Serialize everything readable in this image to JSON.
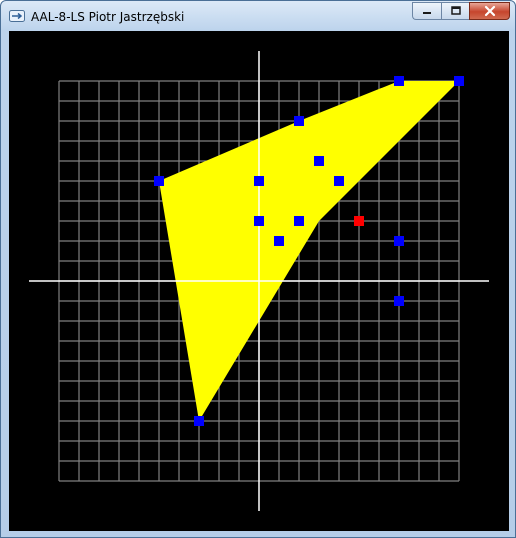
{
  "window": {
    "title": "AAL-8-LS Piotr Jastrzębski",
    "icon": "app-window-icon",
    "buttons": [
      "minimize-icon",
      "maximize-icon",
      "close-icon"
    ]
  },
  "plot": {
    "grid": {
      "range": [
        -10,
        10
      ],
      "step": 1
    },
    "colors": {
      "background": "#000000",
      "grid": "#808080",
      "axes": "#ffffff",
      "hull_fill": "#ffff00",
      "point": "#0000ff",
      "highlight_point": "#ff0000"
    },
    "hull": [
      [
        -5,
        5
      ],
      [
        2,
        8
      ],
      [
        7,
        10
      ],
      [
        10,
        10
      ],
      [
        3,
        3
      ],
      [
        -3,
        -7
      ]
    ],
    "points": [
      [
        -5,
        5
      ],
      [
        2,
        8
      ],
      [
        7,
        10
      ],
      [
        10,
        10
      ],
      [
        -3,
        -7
      ],
      [
        0,
        5
      ],
      [
        0,
        3
      ],
      [
        1,
        2
      ],
      [
        2,
        3
      ],
      [
        3,
        6
      ],
      [
        4,
        5
      ],
      [
        7,
        2
      ],
      [
        7,
        -1
      ]
    ],
    "highlight_point": [
      5,
      3
    ]
  }
}
